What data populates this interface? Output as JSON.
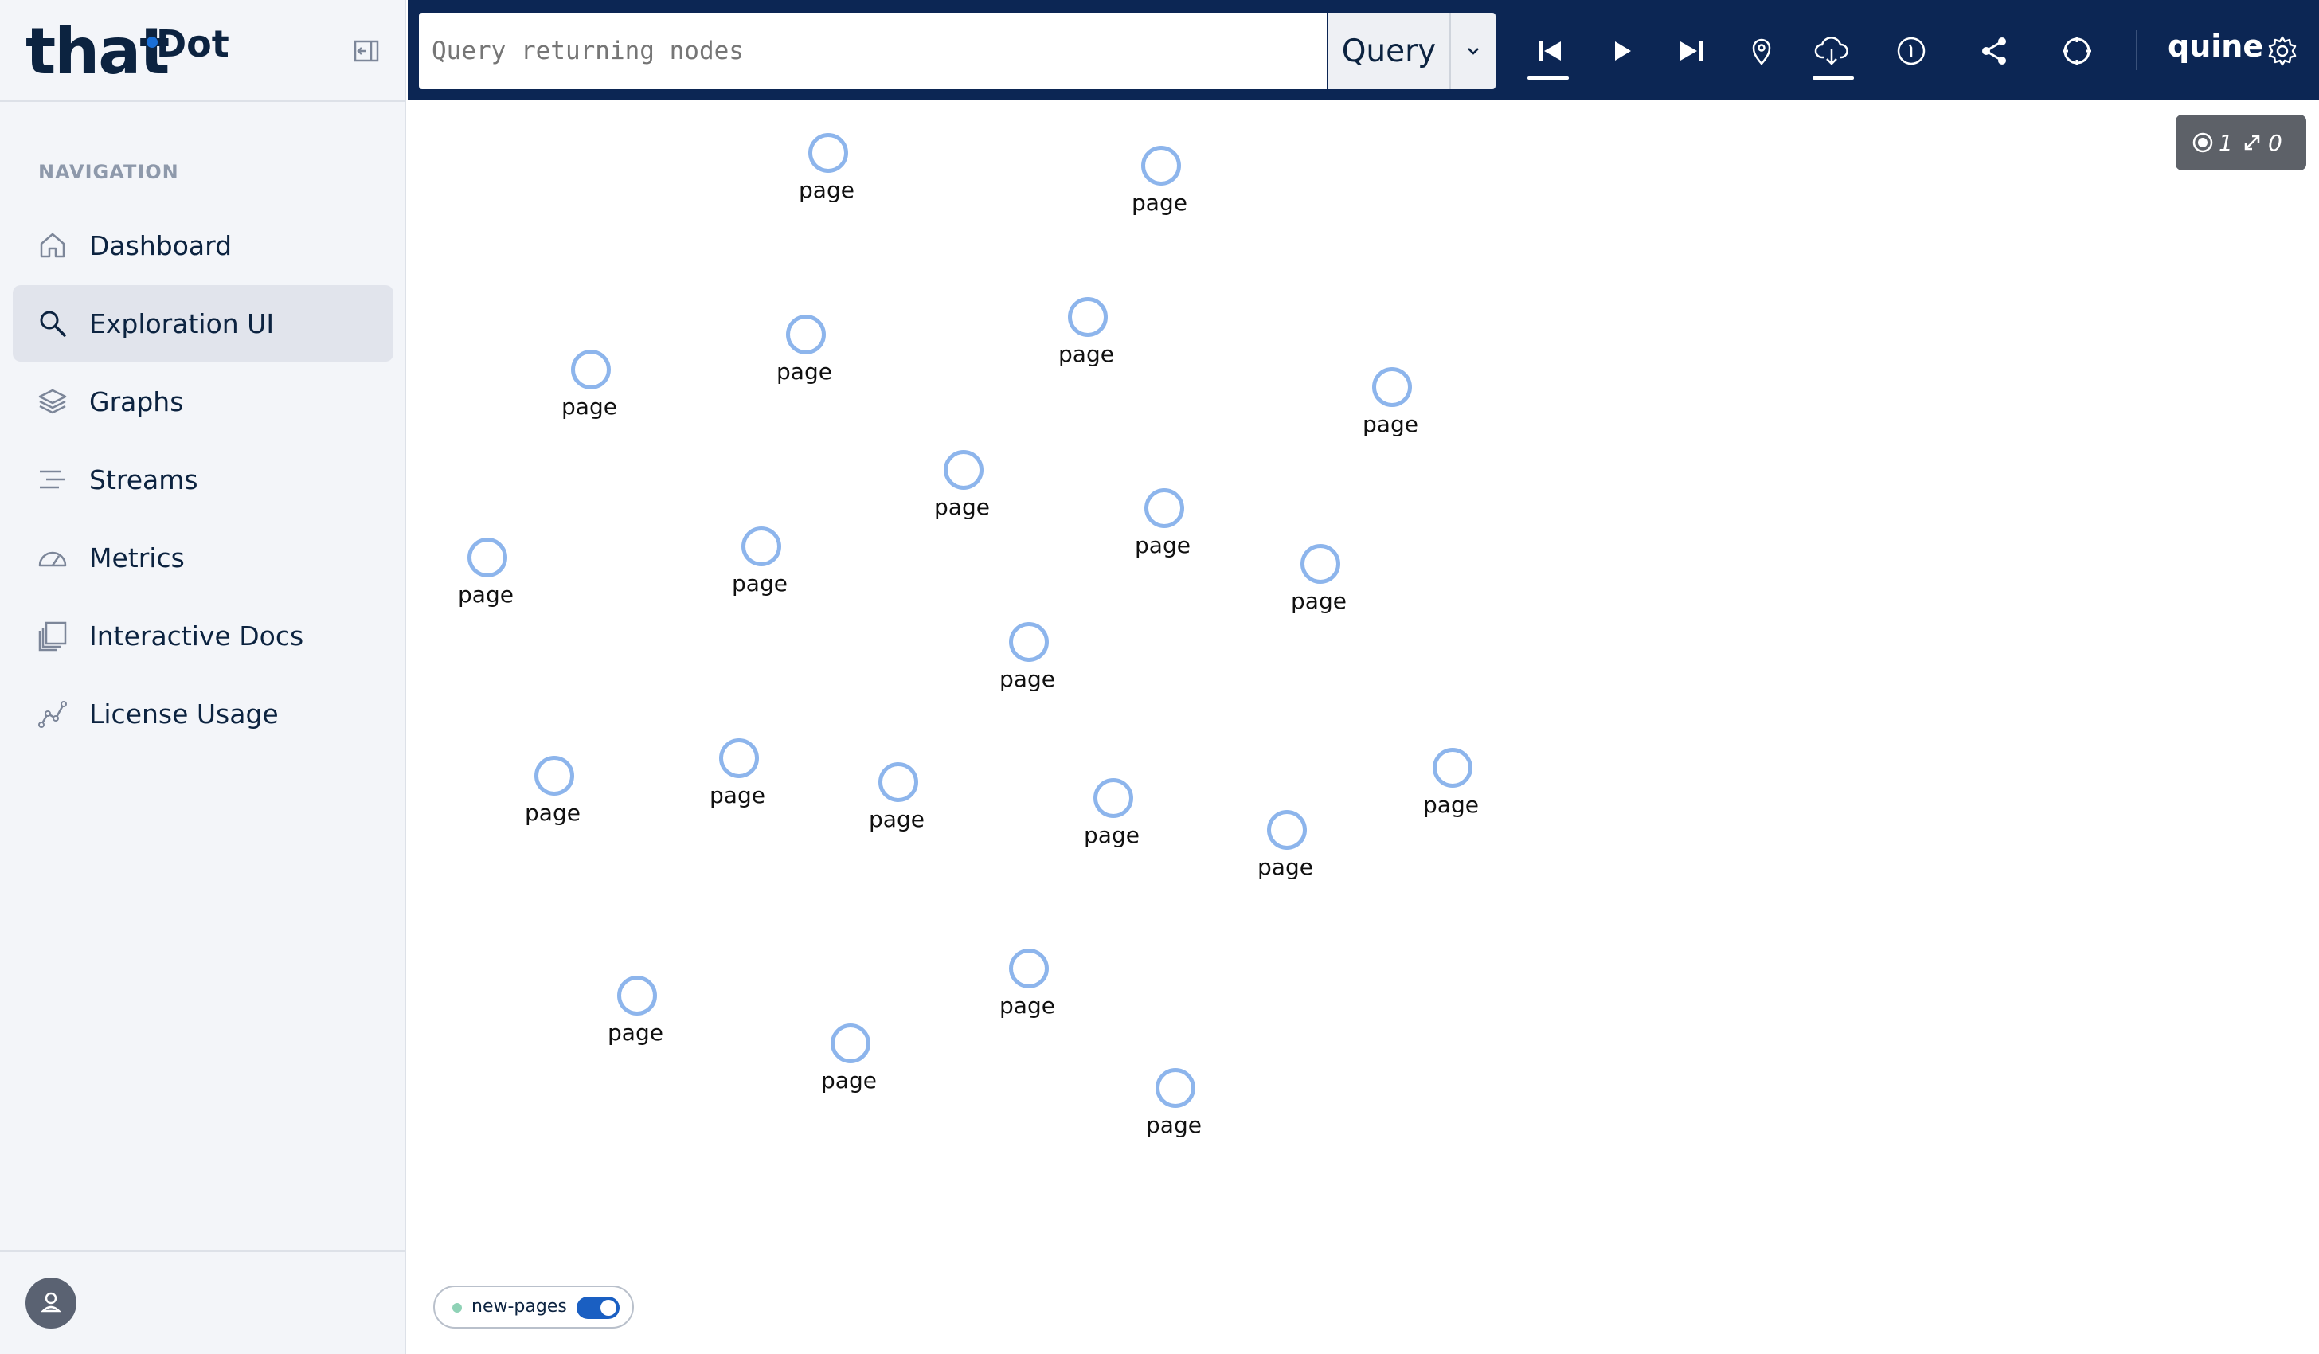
{
  "brand": {
    "logo_main": "that",
    "logo_sup": "Dot"
  },
  "sidebar": {
    "heading": "NAVIGATION",
    "items": [
      {
        "label": "Dashboard",
        "icon": "home-icon",
        "active": false
      },
      {
        "label": "Exploration UI",
        "icon": "search-icon",
        "active": true
      },
      {
        "label": "Graphs",
        "icon": "layers-icon",
        "active": false
      },
      {
        "label": "Streams",
        "icon": "streams-icon",
        "active": false
      },
      {
        "label": "Metrics",
        "icon": "gauge-icon",
        "active": false
      },
      {
        "label": "Interactive Docs",
        "icon": "docs-icon",
        "active": false
      },
      {
        "label": "License Usage",
        "icon": "usage-chart-icon",
        "active": false
      }
    ]
  },
  "toolbar": {
    "query_placeholder": "Query returning nodes",
    "query_value": "",
    "query_button_label": "Query",
    "product_name": "quine"
  },
  "counter": {
    "nodes": "1",
    "edges": "0"
  },
  "graph": {
    "node_label": "page",
    "node_color": "#8db5ec"
  },
  "filter": {
    "label": "new-pages",
    "enabled": true
  },
  "colors": {
    "topbar": "#0c2654",
    "sidebar": "#f3f5f9",
    "accent": "#1a5fc2"
  }
}
